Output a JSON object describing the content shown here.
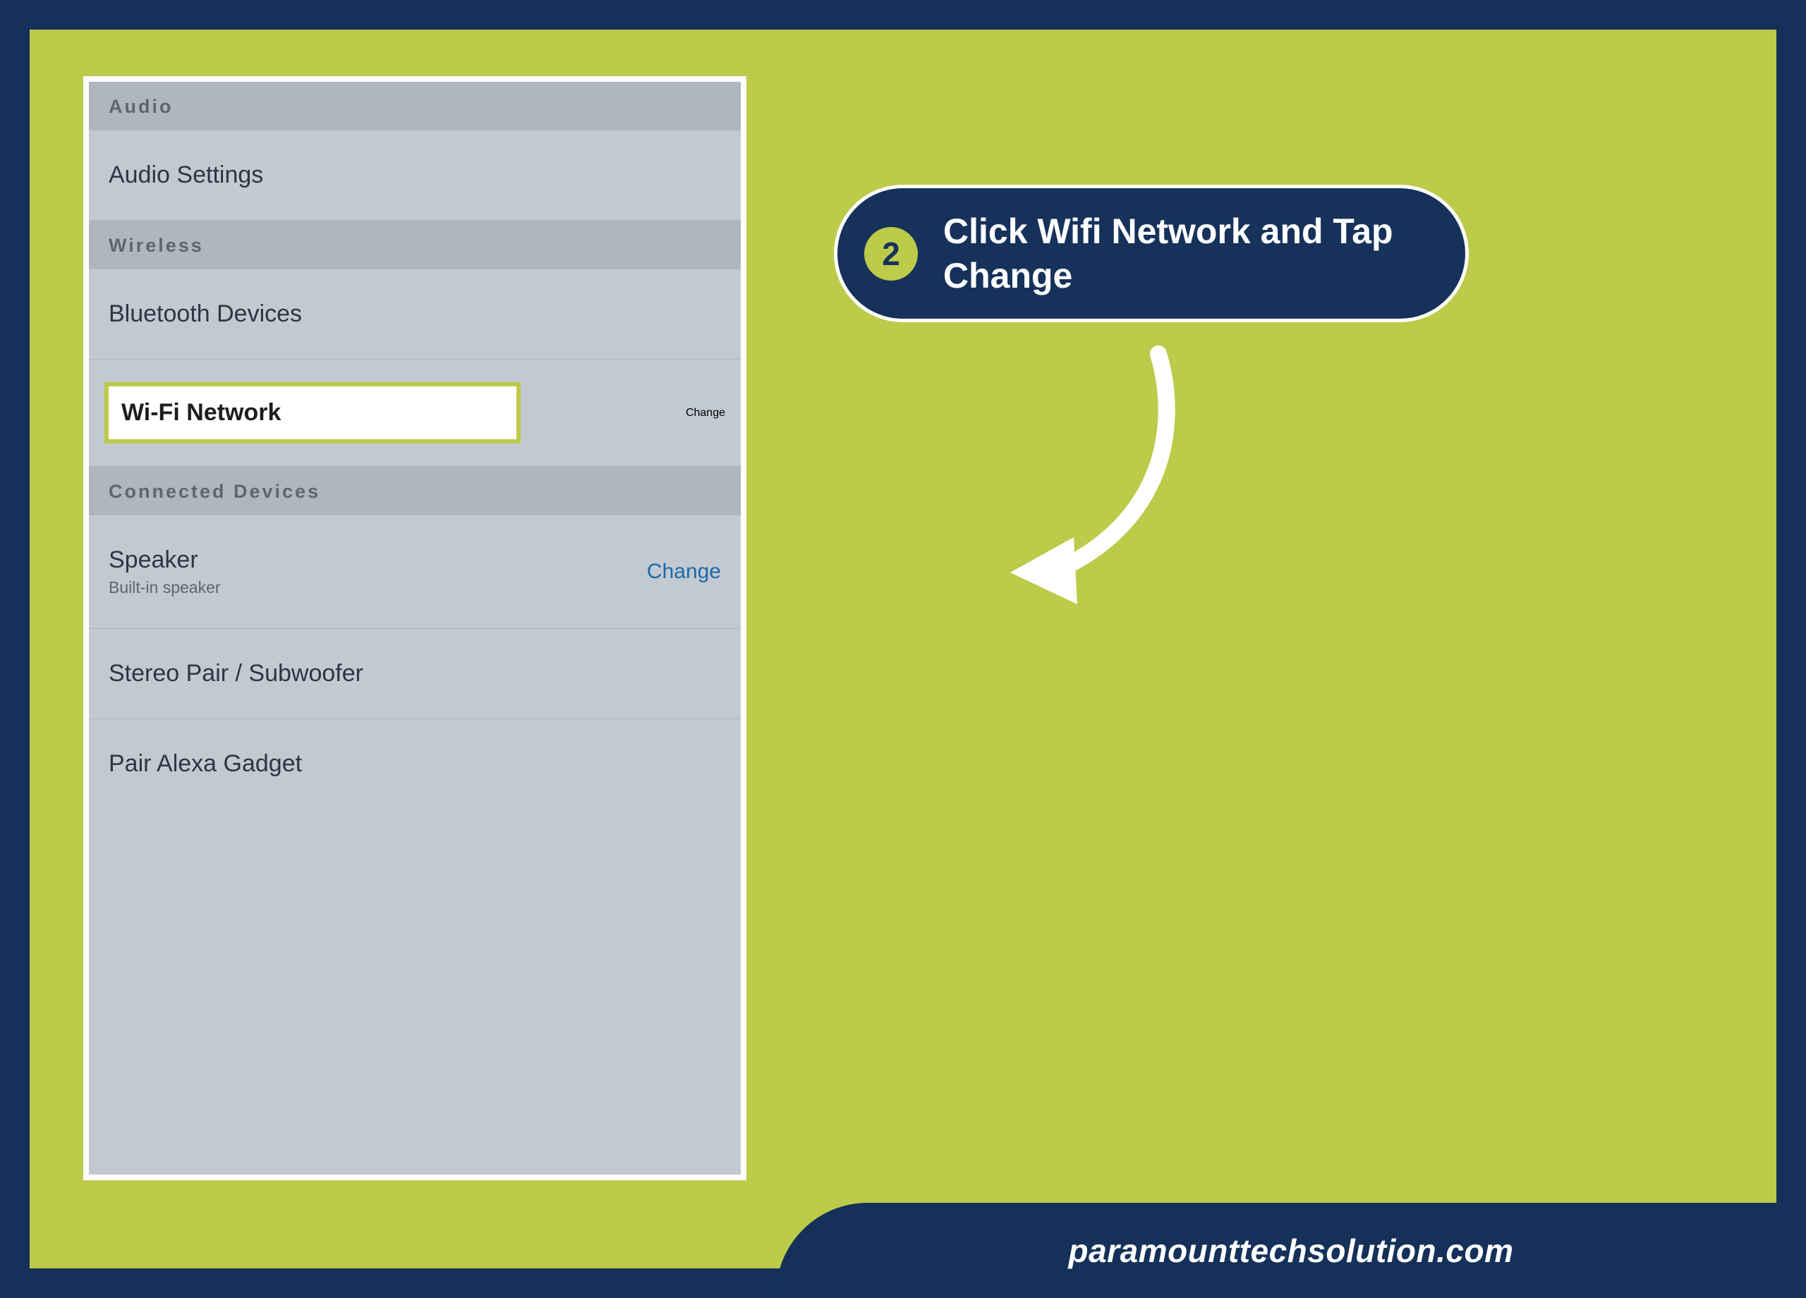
{
  "sections": {
    "audio": {
      "header": "Audio",
      "items": [
        {
          "title": "Audio Settings"
        }
      ]
    },
    "wireless": {
      "header": "Wireless",
      "items": [
        {
          "title": "Bluetooth Devices"
        },
        {
          "title": "Wi-Fi Network",
          "action": "Change",
          "highlighted": true
        }
      ]
    },
    "connected": {
      "header": "Connected Devices",
      "items": [
        {
          "title": "Speaker",
          "sub": "Built-in speaker",
          "action": "Change"
        },
        {
          "title": "Stereo Pair / Subwoofer"
        },
        {
          "title": "Pair Alexa Gadget"
        }
      ]
    }
  },
  "callout": {
    "step": "2",
    "text": "Click Wifi Network and Tap Change"
  },
  "footer": {
    "text": "paramounttechsolution.com"
  },
  "colors": {
    "frame": "#15315a",
    "canvas": "#bccb49",
    "panel": "#c2c9d1",
    "headerBand": "#afb6be",
    "link": "#1a6aa8"
  }
}
